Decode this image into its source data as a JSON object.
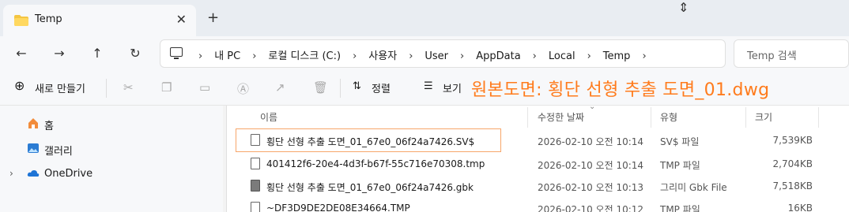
{
  "tab": {
    "title": "Temp",
    "close_label": "✕",
    "new_tab_label": "+"
  },
  "nav": {
    "back": "←",
    "forward": "→",
    "up": "↑",
    "refresh": "↻"
  },
  "breadcrumbs": [
    "내 PC",
    "로컬 디스크 (C:)",
    "사용자",
    "User",
    "AppData",
    "Local",
    "Temp"
  ],
  "search": {
    "placeholder": "Temp 검색"
  },
  "commands": {
    "new_label": "새로 만들기",
    "sort_label": "정렬",
    "view_label": "보기"
  },
  "overlay_text": "원본도면:  횡단 선형 추출 도면_01.dwg",
  "sidebar": {
    "items": [
      {
        "label": "홈"
      },
      {
        "label": "갤러리"
      },
      {
        "label": "OneDrive"
      }
    ]
  },
  "columns": {
    "name": "이름",
    "date": "수정한 날짜",
    "type": "유형",
    "size": "크기"
  },
  "files": [
    {
      "name": "횡단 선형 추출 도면_01_67e0_06f24a7426.SV$",
      "date": "2026-02-10 오전 10:14",
      "type": "SV$ 파일",
      "size": "7,539KB"
    },
    {
      "name": "401412f6-20e4-4d3f-b67f-55c716e70308.tmp",
      "date": "2026-02-10 오전 10:14",
      "type": "TMP 파일",
      "size": "2,704KB"
    },
    {
      "name": "횡단 선형 추출 도면_01_67e0_06f24a7426.gbk",
      "date": "2026-02-10 오전 10:13",
      "type": "그리미 Gbk File",
      "size": "7,518KB"
    },
    {
      "name": "~DF3D9DE2DE08E34664.TMP",
      "date": "2026-02-10 오전 10:12",
      "type": "TMP 파일",
      "size": "16KB"
    }
  ],
  "colors": {
    "accent": "#ff7b1c",
    "folder": "#f4c542"
  }
}
